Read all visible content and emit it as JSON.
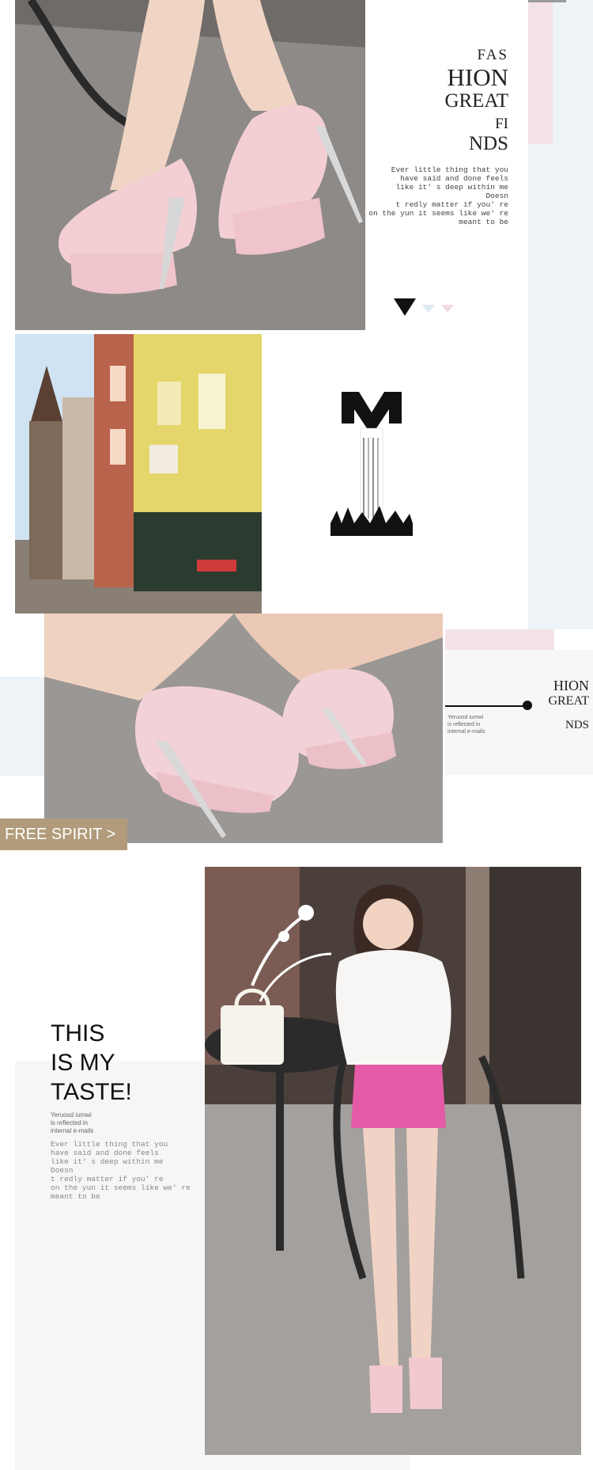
{
  "hero": {
    "heading_lines": [
      "FAS",
      "HION",
      "GREAT",
      "FI",
      "NDS"
    ],
    "body": "Ever little thing that you\nhave said and done feels\nlike it' s deep within me\nDoesn\nt redly matter if you' re\non the yun it seems like we' re\nmeant to be"
  },
  "right_panel": {
    "heading_lines": [
      "HION",
      "GREAT",
      "NDS"
    ],
    "caption": "Yeruosd iumwi\nis reflected in\ninternal e-mails"
  },
  "banner": {
    "label": "FREE SPIRIT >",
    "color": "#b19b7a"
  },
  "taste": {
    "title_lines": [
      "THIS",
      "IS MY",
      "TASTE!"
    ],
    "caption": "Yeruosd iumwi\nis reflected in\ninternal e-mails",
    "body": "Ever little thing that you\nhave said and done feels\nlike it' s deep within me\nDoesn\nt redly matter if you' re\non the yun it seems like we' re\nmeant to be"
  },
  "colors": {
    "pink_accent": "#f3e2e6",
    "light_blue": "#eef3f8",
    "panel_gray": "#f6f6f6"
  }
}
